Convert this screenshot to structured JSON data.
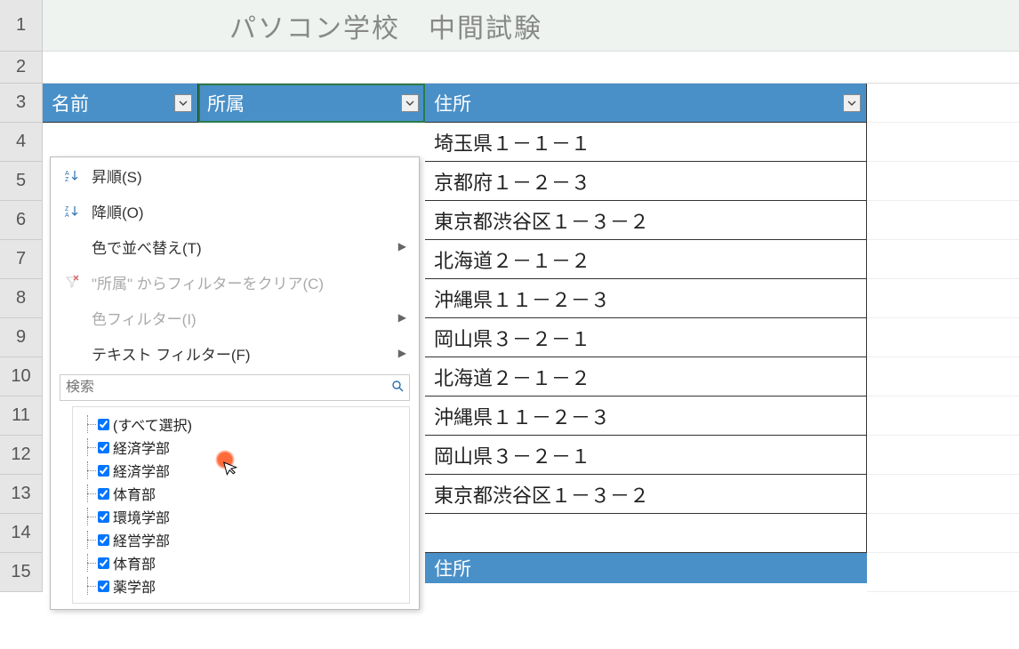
{
  "title": "パソコン学校　中間試験",
  "row_headers": [
    "1",
    "2",
    "3",
    "4",
    "5",
    "6",
    "7",
    "8",
    "9",
    "10",
    "11",
    "12",
    "13",
    "14",
    "15"
  ],
  "columns": {
    "name": "名前",
    "dept": "所属",
    "addr": "住所"
  },
  "addr_rows": [
    "埼玉県１－１－１",
    "京都府１－２－３",
    "東京都渋谷区１－３－２",
    "北海道２－１－２",
    "沖縄県１１－２－３",
    "岡山県３－２－１",
    "北海道２－１－２",
    "沖縄県１１－２－３",
    "岡山県３－２－１",
    "東京都渋谷区１－３－２"
  ],
  "second_hdr": "住所",
  "menu": {
    "asc": "昇順(S)",
    "desc": "降順(O)",
    "sortcolor": "色で並べ替え(T)",
    "clear": "\"所属\" からフィルターをクリア(C)",
    "colorfilter": "色フィルター(I)",
    "textfilter": "テキスト フィルター(F)",
    "search_ph": "検索"
  },
  "chk": [
    "(すべて選択)",
    "経済学部",
    "経済学部",
    "体育部",
    "環境学部",
    "経営学部",
    "体育部",
    "薬学部"
  ]
}
